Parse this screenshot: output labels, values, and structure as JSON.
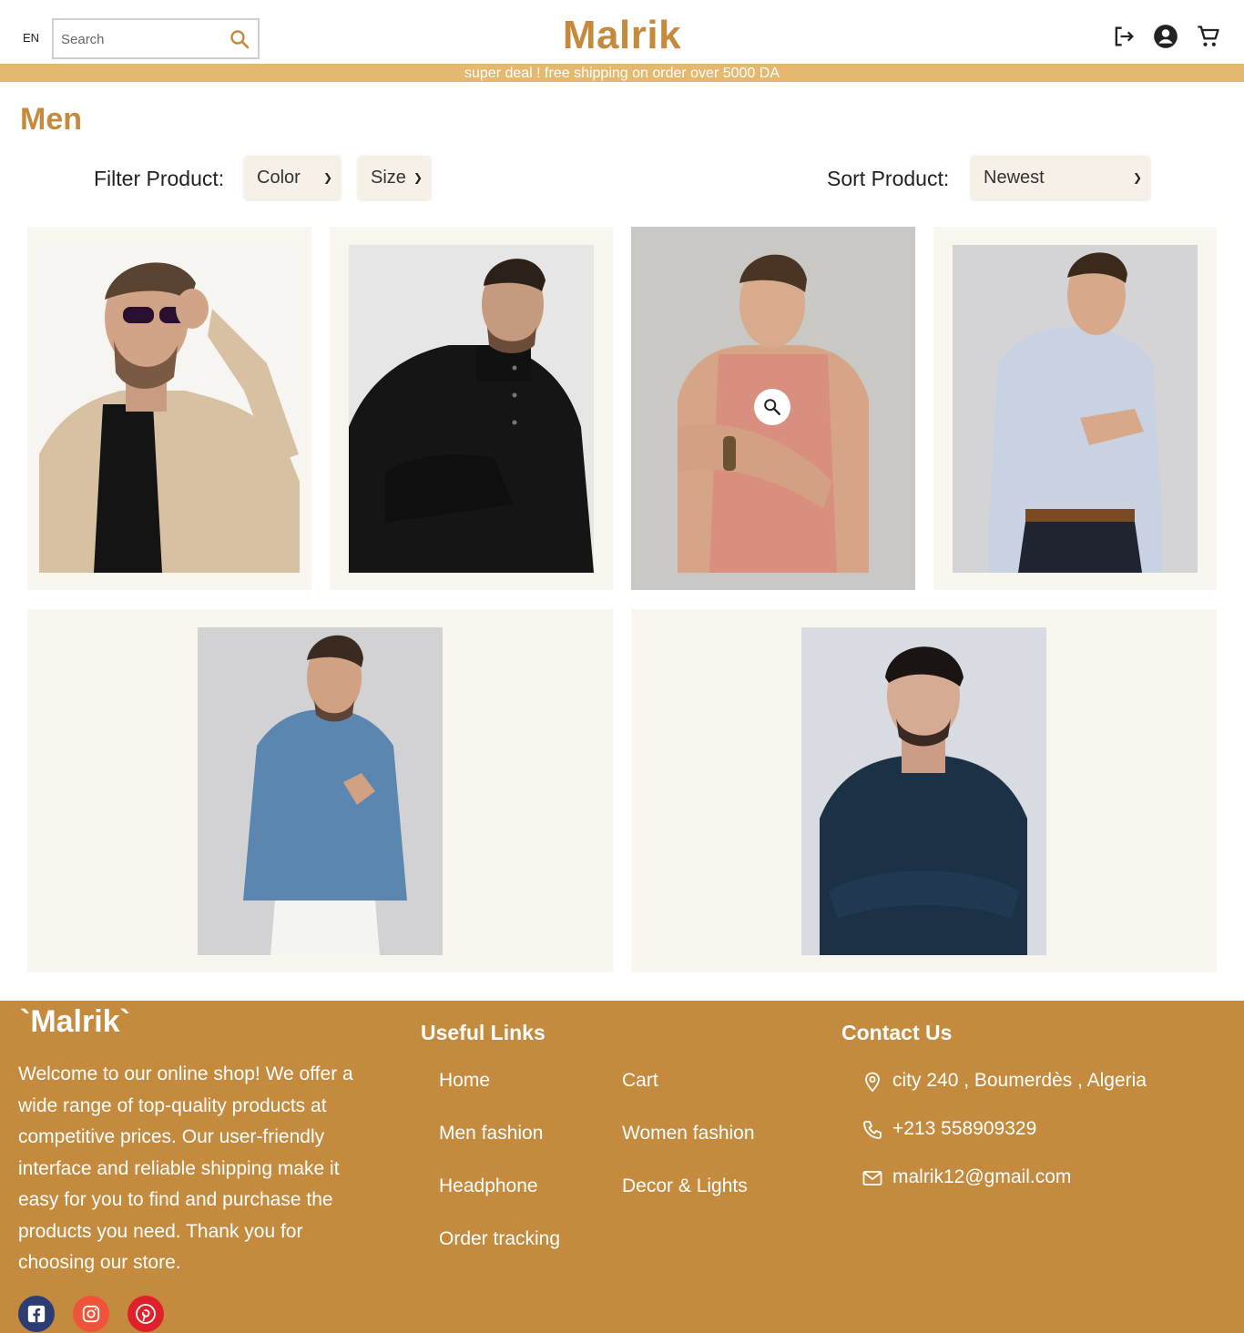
{
  "header": {
    "language": "EN",
    "search": {
      "placeholder": "Search",
      "value": ""
    },
    "brand": "Malrik",
    "icons": [
      "logout-icon",
      "account-icon",
      "cart-icon"
    ]
  },
  "promo_banner": "super deal ! free shipping on order over 5000 DA",
  "page": {
    "title": "Men",
    "filter": {
      "label": "Filter Product:",
      "color_selected": "Color",
      "size_selected": "Size"
    },
    "sort": {
      "label": "Sort Product:",
      "selected": "Newest"
    }
  },
  "products": [
    {
      "depiction": "man-in-beige-blazer-and-sunglasses"
    },
    {
      "depiction": "man-in-black-turtleneck-sweater"
    },
    {
      "depiction": "man-in-pink-tank-top",
      "hovered": true
    },
    {
      "depiction": "man-in-light-blue-shirt"
    },
    {
      "depiction": "man-in-denim-shirt"
    },
    {
      "depiction": "man-in-navy-shirt-arms-crossed"
    }
  ],
  "footer": {
    "brand": "`Malrik`",
    "description": "Welcome to our online shop! We offer a wide range of top-quality products at competitive prices. Our user-friendly interface and reliable shipping make it easy for you to find and purchase the products you need. Thank you for choosing our store.",
    "useful_links": {
      "title": "Useful Links",
      "links": [
        "Home",
        "Cart",
        "Men fashion",
        "Women fashion",
        "Headphone",
        "Decor & Lights",
        "Order tracking"
      ]
    },
    "contact": {
      "title": "Contact Us",
      "address": "city 240 , Boumerdès , Algeria",
      "phone": "+213 558909329",
      "email": "malrik12@gmail.com"
    },
    "social": [
      "facebook-icon",
      "instagram-icon",
      "pinterest-icon"
    ]
  },
  "colors": {
    "brand": "#c48a3e",
    "promo": "#e4b86e",
    "card_bg": "#f9f6ef",
    "select_bg": "#f6f0e6",
    "facebook": "#2d3d72",
    "instagram": "#f0523a",
    "pinterest": "#e0202a"
  }
}
